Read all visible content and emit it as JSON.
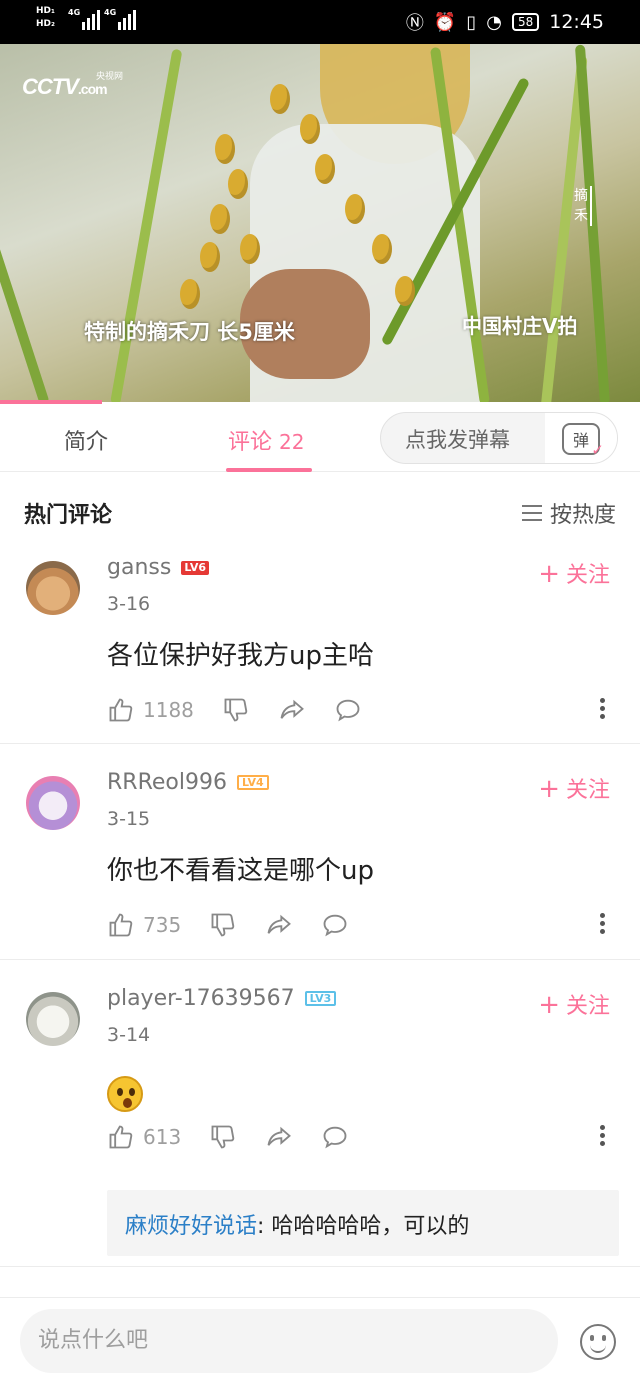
{
  "status_bar": {
    "sim1": "HD₁",
    "sim2": "HD₂",
    "net1": "4G",
    "net2": "4G",
    "battery": "58",
    "time": "12:45"
  },
  "video": {
    "channel_logo": "CCTV",
    "channel_logo_suffix": ".com",
    "channel_sub": "央视网",
    "subtitle": "特制的摘禾刀 长5厘米",
    "program_logo": "中国村庄V拍",
    "side_caption": "摘禾",
    "progress_fraction": 0.16
  },
  "tabs": {
    "intro": "简介",
    "comments": "评论",
    "comments_count": "22",
    "danmaku_placeholder": "点我发弹幕",
    "danmaku_button": "弹"
  },
  "hot": {
    "title": "热门评论",
    "sort_label": "按热度"
  },
  "comments": [
    {
      "username": "ganss",
      "level": "LV6",
      "date": "3-16",
      "text": "各位保护好我方up主哈",
      "likes": "1188",
      "follow": "关注"
    },
    {
      "username": "RRReol996",
      "level": "LV4",
      "date": "3-15",
      "text": "你也不看看这是哪个up",
      "likes": "735",
      "follow": "关注"
    },
    {
      "username": "player-17639567",
      "level": "LV3",
      "date": "3-14",
      "emoji": "astonished-face",
      "likes": "613",
      "follow": "关注",
      "reply": {
        "user": "麻烦好好说话",
        "text": ": 哈哈哈哈哈，可以的"
      }
    }
  ],
  "bottom": {
    "input_placeholder": "说点什么吧"
  },
  "colors": {
    "accent": "#fb7299",
    "reply_user": "#2b7fc7",
    "lv6": "#e53935",
    "lv4": "#ffae48",
    "lv3": "#5cc0e8"
  }
}
